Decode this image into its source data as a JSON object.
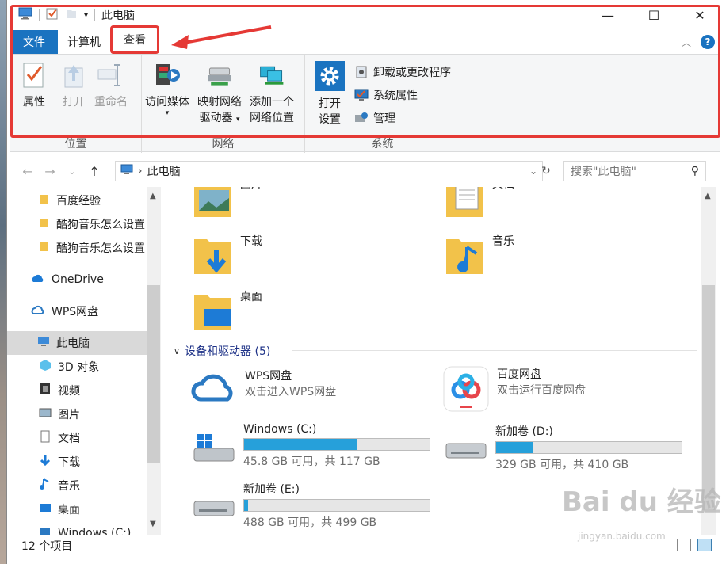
{
  "window": {
    "title": "此电脑"
  },
  "title_controls": {
    "minimize": "—",
    "maximize": "☐",
    "close": "✕"
  },
  "tabs": [
    {
      "label": "文件"
    },
    {
      "label": "计算机"
    },
    {
      "label": "查看"
    }
  ],
  "ribbon": {
    "groups": [
      {
        "label": "位置"
      },
      {
        "label": "网络"
      },
      {
        "label": "系统"
      }
    ],
    "location": {
      "properties": "属性",
      "open": "打开",
      "rename": "重命名"
    },
    "network": {
      "access_media": "访问媒体",
      "map_drive_1": "映射网络",
      "map_drive_2": "驱动器",
      "add_location_1": "添加一个",
      "add_location_2": "网络位置"
    },
    "system": {
      "open_settings_1": "打开",
      "open_settings_2": "设置",
      "uninstall": "卸载或更改程序",
      "system_props": "系统属性",
      "manage": "管理"
    }
  },
  "address": {
    "path": "此电脑",
    "search_placeholder": "搜索\"此电脑\""
  },
  "nav": {
    "items": [
      {
        "label": "百度经验"
      },
      {
        "label": "酷狗音乐怎么设置"
      },
      {
        "label": "酷狗音乐怎么设置"
      },
      {
        "label": "OneDrive"
      },
      {
        "label": "WPS网盘"
      },
      {
        "label": "此电脑"
      },
      {
        "label": "3D 对象"
      },
      {
        "label": "视频"
      },
      {
        "label": "图片"
      },
      {
        "label": "文档"
      },
      {
        "label": "下载"
      },
      {
        "label": "音乐"
      },
      {
        "label": "桌面"
      },
      {
        "label": "Windows (C:)"
      }
    ]
  },
  "folders": [
    {
      "label": "图片"
    },
    {
      "label": "文档"
    },
    {
      "label": "下载"
    },
    {
      "label": "音乐"
    },
    {
      "label": "桌面"
    }
  ],
  "devices_header": "设备和驱动器 (5)",
  "devices": [
    {
      "name": "WPS网盘",
      "sub": "双击进入WPS网盘"
    },
    {
      "name": "百度网盘",
      "sub": "双击运行百度网盘"
    }
  ],
  "drives": [
    {
      "name": "Windows (C:)",
      "sub": "45.8 GB 可用，共 117 GB",
      "used_fraction": 0.61
    },
    {
      "name": "新加卷 (D:)",
      "sub": "329 GB 可用，共 410 GB",
      "used_fraction": 0.2
    },
    {
      "name": "新加卷 (E:)",
      "sub": "488 GB 可用，共 499 GB",
      "used_fraction": 0.02
    }
  ],
  "status": {
    "count": "12 个项目"
  },
  "watermark": {
    "text": "Bai du 经验",
    "sub": "jingyan.baidu.com"
  },
  "colors": {
    "accent": "#1a73c0",
    "highlight": "#e53935",
    "drive_fill": "#26a0da"
  }
}
